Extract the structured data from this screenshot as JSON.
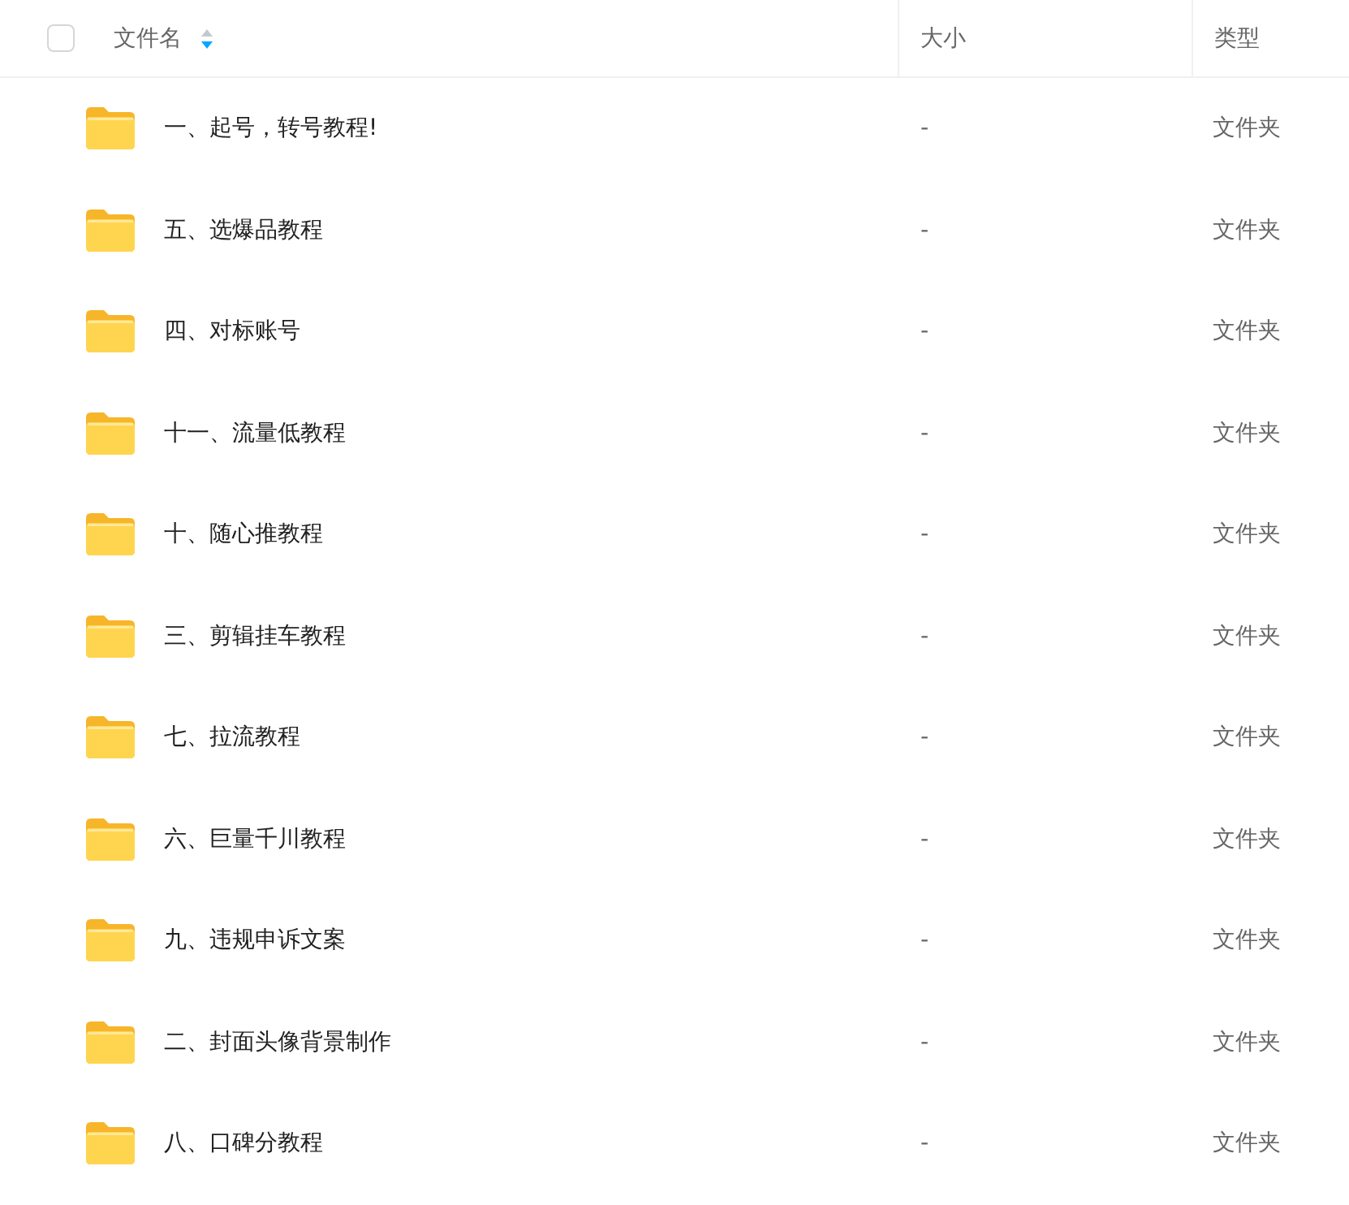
{
  "header": {
    "select_all_checked": false,
    "columns": [
      {
        "label": "文件名",
        "sorted": true,
        "descending": true
      },
      {
        "label": "大小"
      },
      {
        "label": "类型"
      }
    ]
  },
  "rows": [
    {
      "kind": "folder",
      "name": "一、起号，转号教程!",
      "size": "-",
      "type": "文件夹"
    },
    {
      "kind": "folder",
      "name": "五、选爆品教程",
      "size": "-",
      "type": "文件夹"
    },
    {
      "kind": "folder",
      "name": "四、对标账号",
      "size": "-",
      "type": "文件夹"
    },
    {
      "kind": "folder",
      "name": "十一、流量低教程",
      "size": "-",
      "type": "文件夹"
    },
    {
      "kind": "folder",
      "name": "十、随心推教程",
      "size": "-",
      "type": "文件夹"
    },
    {
      "kind": "folder",
      "name": "三、剪辑挂车教程",
      "size": "-",
      "type": "文件夹"
    },
    {
      "kind": "folder",
      "name": "七、拉流教程",
      "size": "-",
      "type": "文件夹"
    },
    {
      "kind": "folder",
      "name": "六、巨量千川教程",
      "size": "-",
      "type": "文件夹"
    },
    {
      "kind": "folder",
      "name": "九、违规申诉文案",
      "size": "-",
      "type": "文件夹"
    },
    {
      "kind": "folder",
      "name": "二、封面头像背景制作",
      "size": "-",
      "type": "文件夹"
    },
    {
      "kind": "folder",
      "name": "八、口碑分教程",
      "size": "-",
      "type": "文件夹"
    }
  ]
}
